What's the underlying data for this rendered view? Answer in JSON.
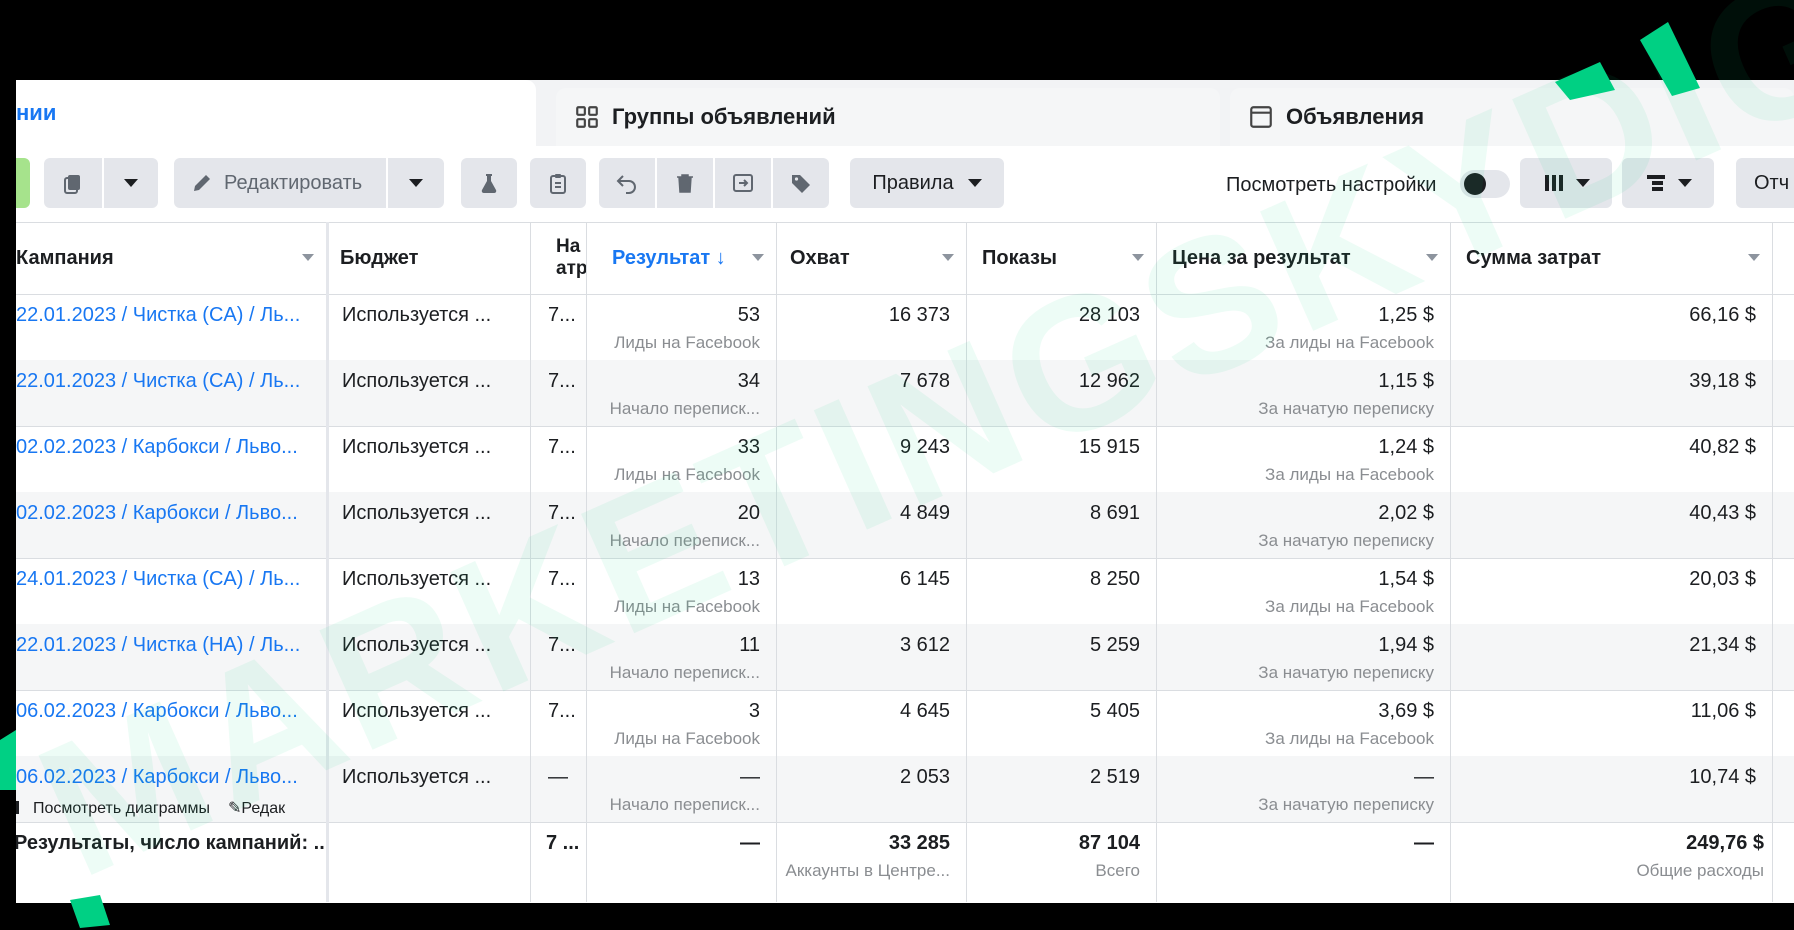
{
  "tabs": {
    "active": "нии",
    "groups": "Группы объявлений",
    "ads": "Объявления"
  },
  "toolbar": {
    "edit": "Редактировать",
    "rules": "Правила",
    "view_settings": "Посмотреть настройки",
    "reports": "Отч"
  },
  "columns": {
    "campaign": "Кампания",
    "budget": "Бюджет",
    "attr": "На атр",
    "result": "Результат ↓",
    "reach": "Охват",
    "impressions": "Показы",
    "cpr": "Цена за результат",
    "spend": "Сумма затрат"
  },
  "rows": [
    {
      "campaign": "22.01.2023 / Чистка (CA) / Ль...",
      "budget": "Используется ...",
      "attr": "7...",
      "result": "53",
      "result_sub": "Лиды на Facebook",
      "reach": "16 373",
      "impressions": "28 103",
      "cpr": "1,25 $",
      "cpr_sub": "За лиды на Facebook",
      "spend": "66,16 $"
    },
    {
      "campaign": "22.01.2023 / Чистка (CA) / Ль...",
      "budget": "Используется ...",
      "attr": "7...",
      "result": "34",
      "result_sub": "Начало переписк...",
      "reach": "7 678",
      "impressions": "12 962",
      "cpr": "1,15 $",
      "cpr_sub": "За начатую переписку",
      "spend": "39,18 $"
    },
    {
      "campaign": "02.02.2023 / Карбокси / Льво...",
      "budget": "Используется ...",
      "attr": "7...",
      "result": "33",
      "result_sub": "Лиды на Facebook",
      "reach": "9 243",
      "impressions": "15 915",
      "cpr": "1,24 $",
      "cpr_sub": "За лиды на Facebook",
      "spend": "40,82 $"
    },
    {
      "campaign": "02.02.2023 / Карбокси / Льво...",
      "budget": "Используется ...",
      "attr": "7...",
      "result": "20",
      "result_sub": "Начало переписк...",
      "reach": "4 849",
      "impressions": "8 691",
      "cpr": "2,02 $",
      "cpr_sub": "За начатую переписку",
      "spend": "40,43 $"
    },
    {
      "campaign": "24.01.2023 / Чистка (CA) / Ль...",
      "budget": "Используется ...",
      "attr": "7...",
      "result": "13",
      "result_sub": "Лиды на Facebook",
      "reach": "6 145",
      "impressions": "8 250",
      "cpr": "1,54 $",
      "cpr_sub": "За лиды на Facebook",
      "spend": "20,03 $"
    },
    {
      "campaign": "22.01.2023 / Чистка (НА) / Ль...",
      "budget": "Используется ...",
      "attr": "7...",
      "result": "11",
      "result_sub": "Начало переписк...",
      "reach": "3 612",
      "impressions": "5 259",
      "cpr": "1,94 $",
      "cpr_sub": "За начатую переписку",
      "spend": "21,34 $"
    },
    {
      "campaign": "06.02.2023 / Карбокси / Льво...",
      "budget": "Используется ...",
      "attr": "7...",
      "result": "3",
      "result_sub": "Лиды на Facebook",
      "reach": "4 645",
      "impressions": "5 405",
      "cpr": "3,69 $",
      "cpr_sub": "За лиды на Facebook",
      "spend": "11,06 $"
    },
    {
      "campaign": "06.02.2023 / Карбокси / Льво...",
      "budget": "Используется ...",
      "attr": "—",
      "result": "—",
      "result_sub": "Начало переписк...",
      "reach": "2 053",
      "impressions": "2 519",
      "cpr": "—",
      "cpr_sub": "За начатую переписку",
      "spend": "10,74 $",
      "actions": {
        "charts": "Посмотреть диаграммы",
        "edit": "Редак"
      }
    }
  ],
  "totals": {
    "label": "Результаты, число кампаний: ...",
    "attr": "7 ...",
    "result": "—",
    "reach": "33 285",
    "reach_sub": "Аккаунты в Центре...",
    "impressions": "87 104",
    "impressions_sub": "Всего",
    "cpr": "—",
    "spend": "249,76 $",
    "spend_sub": "Общие расходы"
  },
  "watermark": "MARKETINGSKYDIGITAL",
  "colors": {
    "link": "#1877f2",
    "accent_green": "#00d084",
    "header_bg": "#f2f3f5"
  }
}
